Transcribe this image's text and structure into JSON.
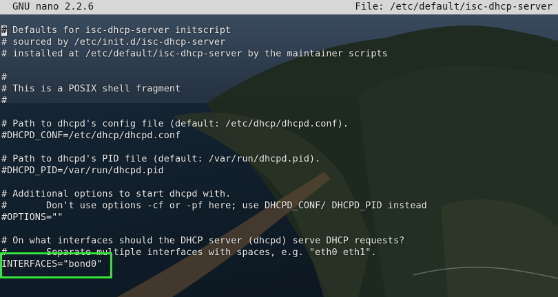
{
  "titlebar": {
    "app": "GNU nano 2.2.6",
    "file": "File: /etc/default/isc-dhcp-server"
  },
  "editor": {
    "lines": [
      "# Defaults for isc-dhcp-server initscript",
      "# sourced by /etc/init.d/isc-dhcp-server",
      "# installed at /etc/default/isc-dhcp-server by the maintainer scripts",
      "",
      "#",
      "# This is a POSIX shell fragment",
      "#",
      "",
      "# Path to dhcpd's config file (default: /etc/dhcp/dhcpd.conf).",
      "#DHCPD_CONF=/etc/dhcp/dhcpd.conf",
      "",
      "# Path to dhcpd's PID file (default: /var/run/dhcpd.pid).",
      "#DHCPD_PID=/var/run/dhcpd.pid",
      "",
      "# Additional options to start dhcpd with.",
      "#       Don't use options -cf or -pf here; use DHCPD_CONF/ DHCPD_PID instead",
      "#OPTIONS=\"\"",
      "",
      "# On what interfaces should the DHCP server (dhcpd) serve DHCP requests?",
      "#       Separate multiple interfaces with spaces, e.g. \"eth0 eth1\".",
      "INTERFACES=\"bond0\""
    ]
  },
  "colors": {
    "titlebar_bg": "#d7d7d7",
    "text": "#e6e6e6",
    "highlight_box": "#36e33a"
  }
}
